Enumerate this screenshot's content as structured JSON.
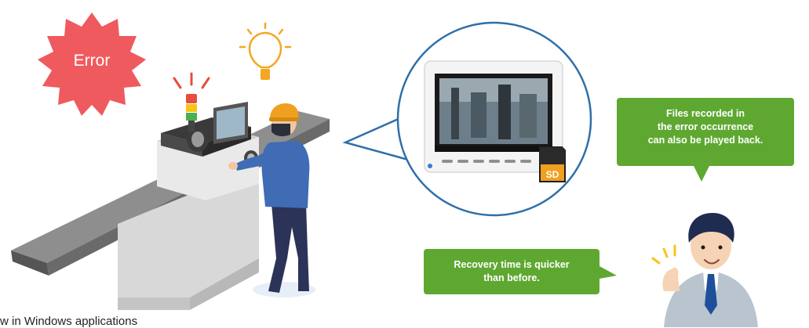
{
  "error_label": "Error",
  "sd_label": "SD",
  "bubble_top": {
    "lines": [
      "Files recorded in",
      "the error occurrence",
      "can also be played back."
    ]
  },
  "bubble_bottom": {
    "lines": [
      "Recovery time is quicker",
      "than before."
    ]
  },
  "footer_fragment": "w in Windows applications",
  "colors": {
    "error_burst": "#ef5a5e",
    "bubble_green": "#5ea831",
    "bulb_orange": "#f5a623",
    "magnifier_ring": "#2f6fa8",
    "worker_shirt": "#3f6cb5",
    "worker_helmet": "#f0a020"
  }
}
